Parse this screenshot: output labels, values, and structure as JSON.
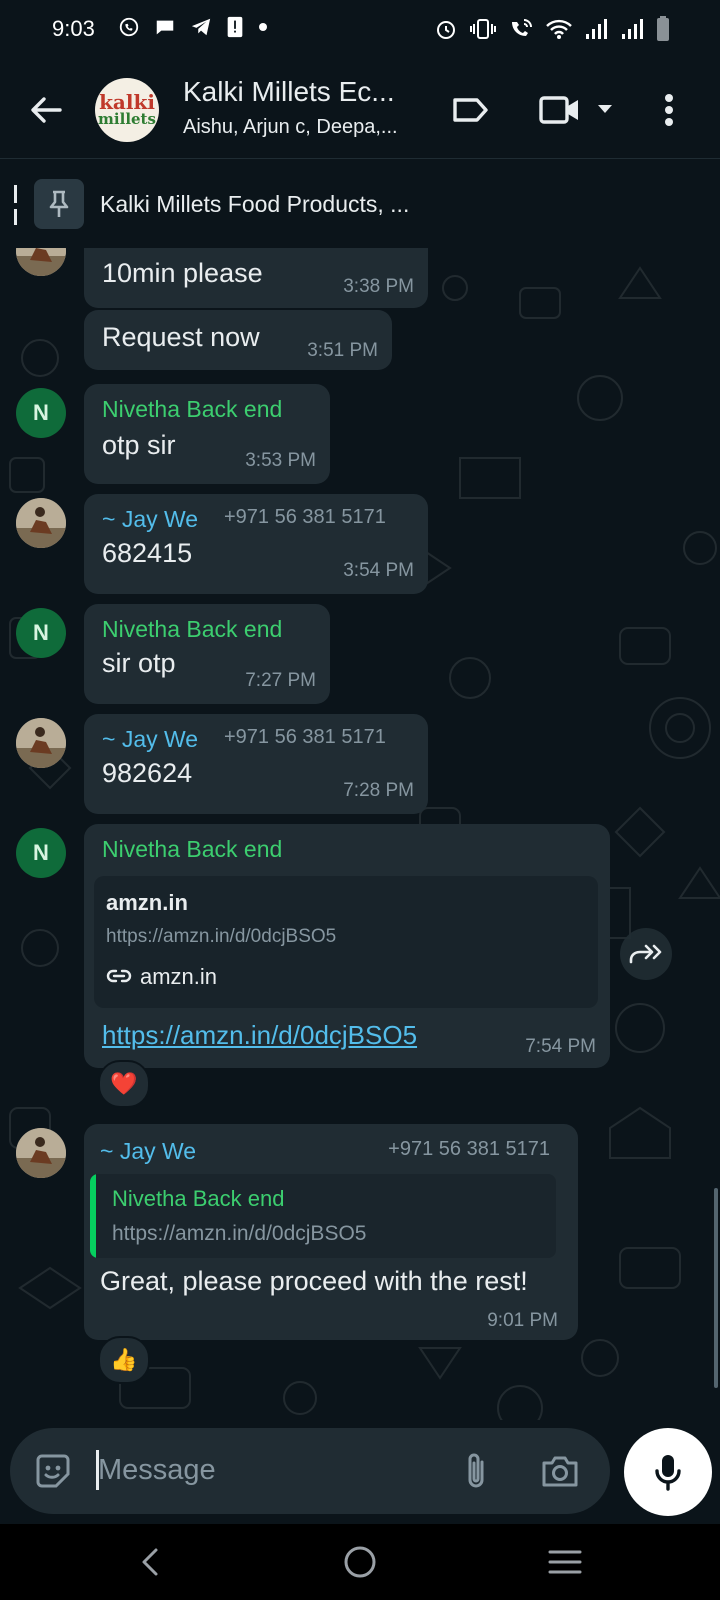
{
  "status_bar": {
    "time": "9:03"
  },
  "header": {
    "avatar_text_line1": "kalki",
    "avatar_text_line2": "millets",
    "title": "Kalki Millets Ec...",
    "subtitle": "Aishu, Arjun c, Deepa,..."
  },
  "pinned": {
    "text": "Kalki Millets Food Products, ..."
  },
  "messages": [
    {
      "text": "10min please",
      "time": "3:38 PM"
    },
    {
      "text": "Request now",
      "time": "3:51 PM"
    },
    {
      "avatar": "N",
      "sender": "Nivetha Back end",
      "text": "otp sir",
      "time": "3:53 PM"
    },
    {
      "sender": "~ Jay We",
      "phone": "+971 56 381 5171",
      "text": "682415",
      "time": "3:54 PM"
    },
    {
      "avatar": "N",
      "sender": "Nivetha Back end",
      "text": "sir otp",
      "time": "7:27 PM"
    },
    {
      "sender": "~ Jay We",
      "phone": "+971 56 381 5171",
      "text": "982624",
      "time": "7:28 PM"
    },
    {
      "avatar": "N",
      "sender": "Nivetha Back end",
      "link_title": "amzn.in",
      "link_url": "https://amzn.in/d/0dcjBSO5",
      "link_domain": "amzn.in",
      "text": "https://amzn.in/d/0dcjBSO5",
      "time": "7:54 PM",
      "reaction": "❤️"
    },
    {
      "sender": "~ Jay We",
      "phone": "+971 56 381 5171",
      "quote_sender": "Nivetha Back end",
      "quote_text": "https://amzn.in/d/0dcjBSO5",
      "text": "Great, please proceed with the rest!",
      "time": "9:01 PM",
      "reaction": "👍"
    }
  ],
  "input": {
    "placeholder": "Message"
  },
  "colors": {
    "background": "#0b141a",
    "bubble": "#202c33",
    "green_sender": "#3cce6f",
    "blue_sender": "#53bdeb",
    "link": "#53bdeb"
  }
}
